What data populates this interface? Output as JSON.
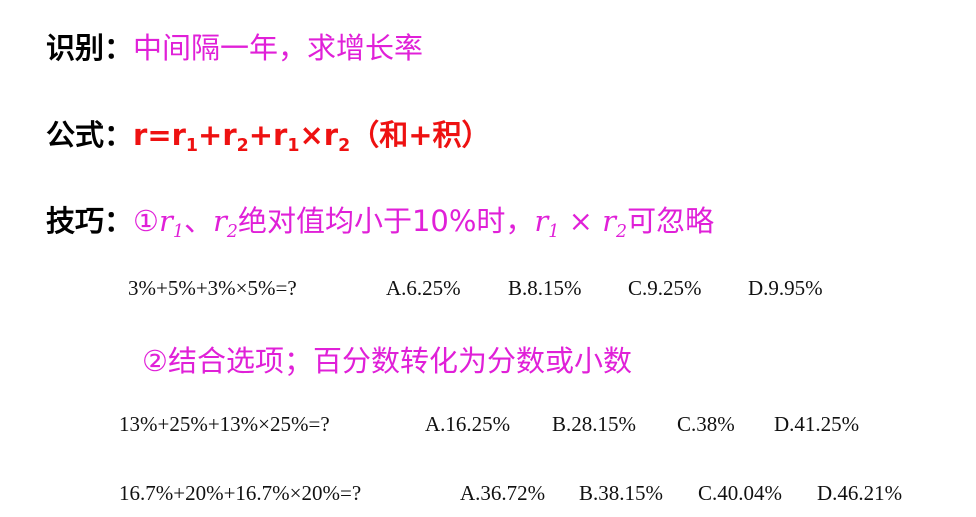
{
  "identify": {
    "label": "识别：",
    "text": "中间隔一年，求增长率"
  },
  "formula": {
    "label": "公式：",
    "r": "r=r",
    "sub1": "1",
    "plus1": "+r",
    "sub2": "2",
    "plus2": "+r",
    "sub3": "1",
    "times": "×r",
    "sub4": "2",
    "paren": "（和+积）"
  },
  "tip": {
    "label": "技巧：",
    "circle": "①",
    "r1": "r",
    "r1_sub": "1",
    "sep": "、",
    "r2": "r",
    "r2_sub": "2",
    "text1": "绝对值均小于10%时，",
    "r1b": "r",
    "r1b_sub": "1",
    "times": " × ",
    "r2b": "r",
    "r2b_sub": "2",
    "text2": "可忽略"
  },
  "q1": {
    "expr": "3%+5%+3%×5%=?",
    "options": [
      "A.6.25%",
      "B.8.15%",
      "C.9.25%",
      "D.9.95%"
    ]
  },
  "tip2": {
    "text": "②结合选项；百分数转化为分数或小数"
  },
  "q2": {
    "expr": "13%+25%+13%×25%=?",
    "options": [
      "A.16.25%",
      "B.28.15%",
      "C.38%",
      "D.41.25%"
    ]
  },
  "q3": {
    "expr": "16.7%+20%+16.7%×20%=?",
    "options": [
      "A.36.72%",
      "B.38.15%",
      "C.40.04%",
      "D.46.21%"
    ]
  },
  "colors": {
    "accent_pink": "#e020d8",
    "accent_red": "#ee1111",
    "text": "#000000"
  }
}
